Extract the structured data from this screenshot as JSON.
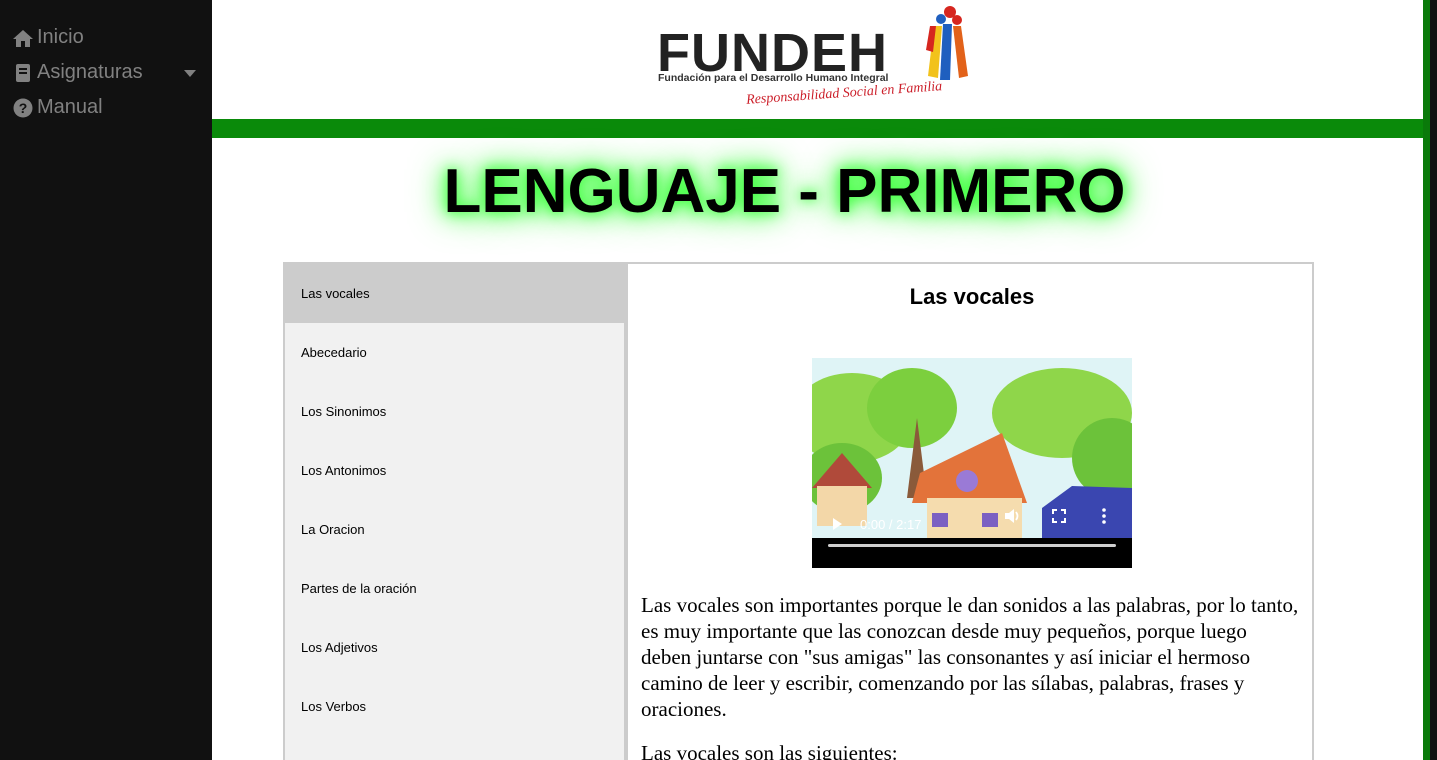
{
  "sidebar": {
    "items": [
      {
        "label": "Inicio",
        "icon": "home-icon"
      },
      {
        "label": "Asignaturas",
        "icon": "book-icon"
      },
      {
        "label": "Manual",
        "icon": "question-circle-icon"
      }
    ]
  },
  "header": {
    "logo_word": "FUNDEH",
    "logo_subtitle": "Fundación para el Desarrollo Humano Integral",
    "logo_tagline": "Responsabilidad Social en Familia"
  },
  "page": {
    "title": "LENGUAJE - PRIMERO"
  },
  "lessons": [
    {
      "label": "Las vocales",
      "active": true
    },
    {
      "label": "Abecedario"
    },
    {
      "label": "Los Sinonimos"
    },
    {
      "label": "Los Antonimos"
    },
    {
      "label": "La Oracion"
    },
    {
      "label": "Partes de la oración"
    },
    {
      "label": "Los Adjetivos"
    },
    {
      "label": "Los Verbos"
    }
  ],
  "content": {
    "heading": "Las vocales",
    "video": {
      "time": "0:00 / 2:17",
      "progress": 0
    },
    "paragraph": "Las vocales son importantes porque le dan sonidos a las palabras, por lo tanto, es muy importante que las conozcan desde muy pequeños, porque luego deben juntarse con \"sus amigas\" las consonantes y así iniciar el hermoso camino de leer y escribir, comenzando por las sílabas, palabras, frases y oraciones.",
    "paragraph2": "Las vocales son las siguientes:"
  },
  "colors": {
    "sidebar_bg": "#111111",
    "sidebar_text": "#818181",
    "accent_green": "#0a8a0a",
    "title_glow": "#3cff3c",
    "active_lesson_bg": "#cccccc"
  }
}
